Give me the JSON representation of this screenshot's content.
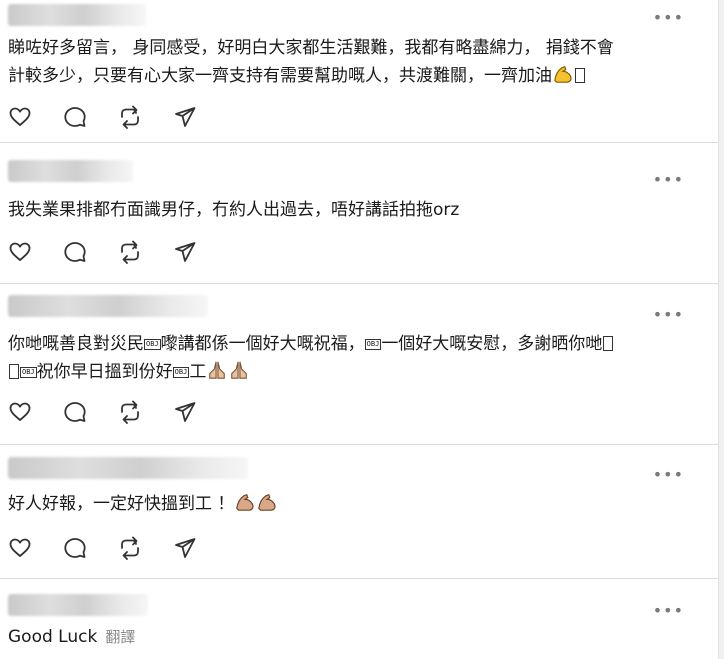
{
  "comments": [
    {
      "text_parts": [
        "睇咗好多留言， 身同感受，好明白大家都生活艱難，我都有略盡綿力， 捐錢不會",
        "計較多少，只要有心大家一齊支持有需要幫助嘅人，共渡難關，一齊加油"
      ],
      "more_label": "•••"
    },
    {
      "text": "我失業果排都冇面識男仔，冇約人出過去，唔好講話拍拖orz",
      "more_label": "•••"
    },
    {
      "line1_a": "你哋嘅善良對災民",
      "line1_b": "嚟講都係一個好大嘅祝福，",
      "line1_c": "一個好大嘅安慰，多謝晒你哋",
      "line2_a": "祝你早日搵到份好",
      "line2_b": "工",
      "obj_label": "OBJ",
      "more_label": "•••"
    },
    {
      "text": "好人好報，一定好快搵到工 ！",
      "more_label": "•••"
    },
    {
      "text": "Good Luck",
      "translate": "翻譯",
      "more_label": "•••"
    }
  ],
  "icons": {
    "like": "heart-icon",
    "reply": "comment-icon",
    "repost": "repost-icon",
    "share": "send-icon",
    "more": "more-icon",
    "flex": "flexed-biceps-emoji",
    "pray": "folded-hands-emoji"
  },
  "colors": {
    "divider": "#dcdcdc",
    "icon": "#333333",
    "muted": "#8a8a8a"
  }
}
